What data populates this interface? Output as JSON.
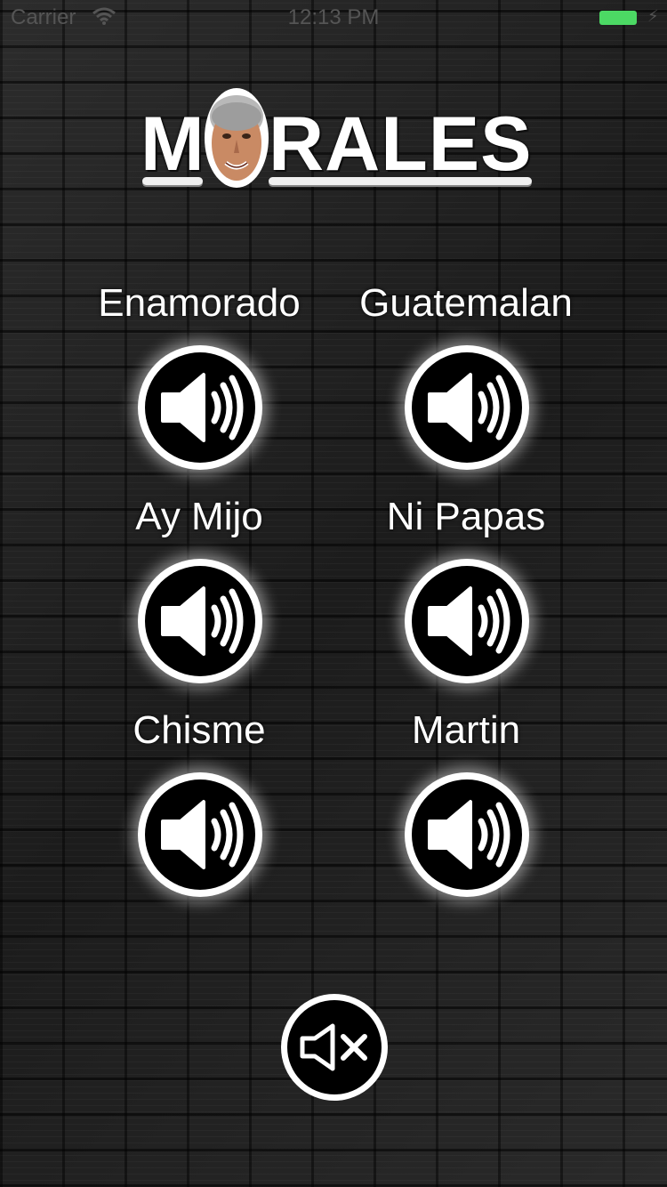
{
  "status_bar": {
    "carrier": "Carrier",
    "time": "12:13 PM",
    "battery_color": "#4cd964"
  },
  "logo": {
    "text_before": "M",
    "text_after": "RALES",
    "face_icon": "face-photo-icon"
  },
  "sounds": [
    {
      "label": "Enamorado",
      "icon": "speaker-icon"
    },
    {
      "label": "Guatemalan",
      "icon": "speaker-icon"
    },
    {
      "label": "Ay Mijo",
      "icon": "speaker-icon"
    },
    {
      "label": "Ni Papas",
      "icon": "speaker-icon"
    },
    {
      "label": "Chisme",
      "icon": "speaker-icon"
    },
    {
      "label": "Martin",
      "icon": "speaker-icon"
    }
  ],
  "mute": {
    "icon": "mute-speaker-icon"
  }
}
